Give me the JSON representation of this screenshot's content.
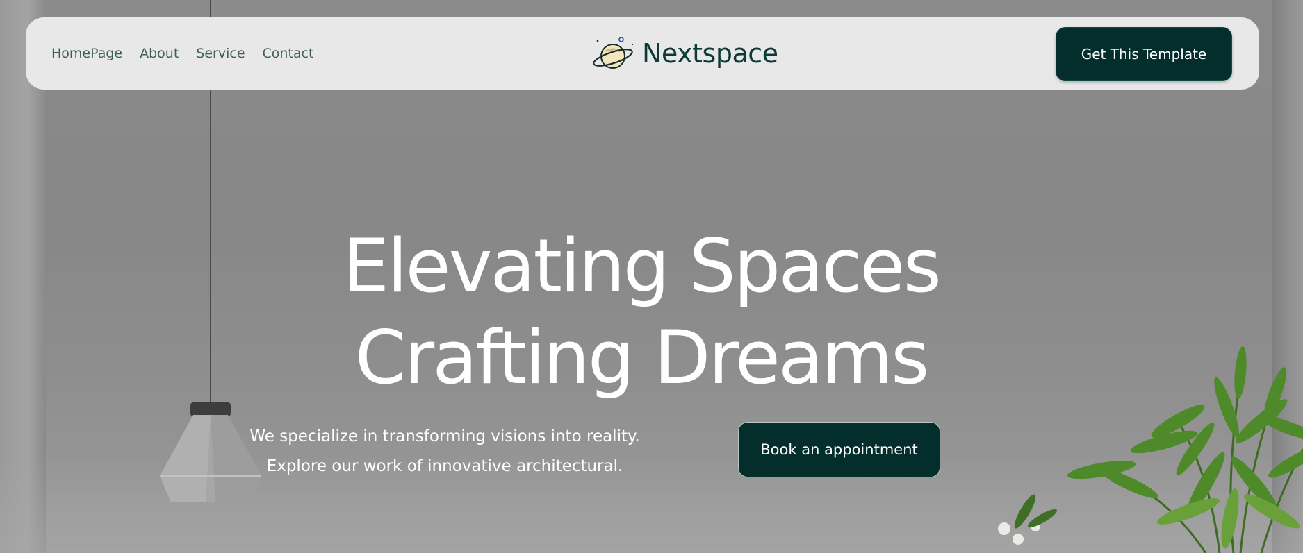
{
  "nav": {
    "links": [
      {
        "label": "HomePage"
      },
      {
        "label": "About"
      },
      {
        "label": "Service"
      },
      {
        "label": "Contact"
      }
    ],
    "brand": "Nextspace",
    "cta_label": "Get This Template"
  },
  "hero": {
    "headline_line1": "Elevating Spaces",
    "headline_line2": "Crafting Dreams",
    "sub_line1": "We specialize in transforming visions into reality.",
    "sub_line2": "Explore our work of innovative architectural.",
    "book_label": "Book an appointment"
  },
  "icons": {
    "brand": "planet-icon"
  },
  "colors": {
    "primary_dark": "#032e2b",
    "brand_text": "#0d3b37",
    "nav_text": "#3e5f59",
    "navbar_bg": "#e8e8e8",
    "hero_text": "#ffffff"
  }
}
